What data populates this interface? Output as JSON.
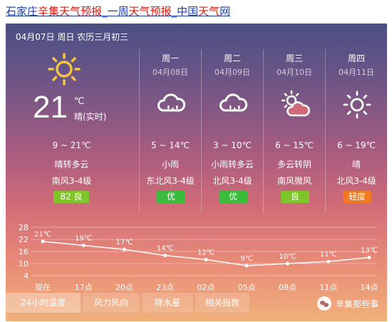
{
  "header": {
    "title_parts": [
      "石家庄",
      "辛集天气预报",
      "_一周",
      "天气预报",
      "_中国",
      "天气",
      "网"
    ]
  },
  "today": {
    "date_line": "04月07日 周日 农历三月初三",
    "temp_now": "21",
    "unit": "℃",
    "cond_now": "晴(实时)",
    "range": "9 ~ 21℃",
    "condition": "晴转多云",
    "wind": "南风3-4级",
    "aqi": "82 良",
    "aqi_color": "#7ec52c",
    "icon": "sun-icon"
  },
  "forecast": [
    {
      "name": "周一",
      "date": "04月08日",
      "icon": "cloud-rain-icon",
      "range": "5 ~ 14℃",
      "condition": "小雨",
      "wind": "东北风3-4级",
      "aqi": "优",
      "aqi_color": "#3bbb3b"
    },
    {
      "name": "周二",
      "date": "04月09日",
      "icon": "cloud-rain-icon",
      "range": "3 ~ 10℃",
      "condition": "小雨转多云",
      "wind": "北风3-4级",
      "aqi": "优",
      "aqi_color": "#3bbb3b"
    },
    {
      "name": "周三",
      "date": "04月10日",
      "icon": "sun-cloud-icon",
      "range": "6 ~ 15℃",
      "condition": "多云转阴",
      "wind": "南风微风",
      "aqi": "良",
      "aqi_color": "#7ec52c"
    },
    {
      "name": "周四",
      "date": "04月11日",
      "icon": "sun-icon",
      "range": "6 ~ 19℃",
      "condition": "晴",
      "wind": "北风3-4级",
      "aqi": "轻度",
      "aqi_color": "#f07a22"
    }
  ],
  "chart_data": {
    "type": "line",
    "categories": [
      "现在",
      "17点",
      "20点",
      "23点",
      "02点",
      "05点",
      "08点",
      "11点",
      "14点"
    ],
    "series": [
      {
        "values": [
          21,
          19,
          17,
          14,
          12,
          9,
          10,
          11,
          13
        ]
      }
    ],
    "point_labels": [
      "21℃",
      "19℃",
      "17℃",
      "14℃",
      "12℃",
      "9℃",
      "10℃",
      "11℃",
      "13℃"
    ],
    "yticks": [
      "28",
      "22",
      "16",
      "10",
      "4"
    ],
    "ylim": [
      4,
      28
    ],
    "grid": true
  },
  "tabs": [
    "24小时温度",
    "风力风向",
    "降水量",
    "相关指数"
  ],
  "watermark": "辛集那些事"
}
